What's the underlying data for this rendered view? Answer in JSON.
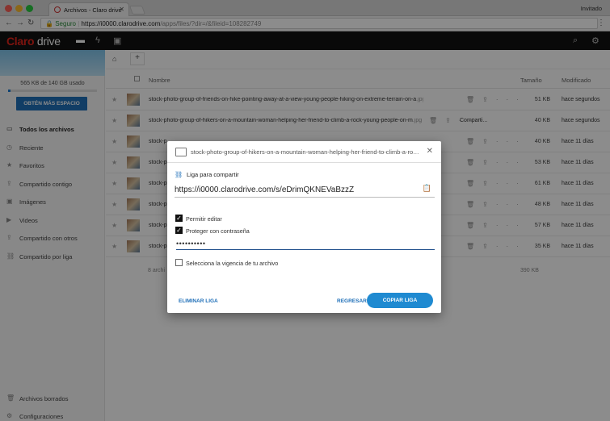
{
  "browser": {
    "tab_title": "Archivos - Claro drive",
    "guest_label": "Invitado",
    "secure_label": "Seguro",
    "url_domain": "https://i0000.clarodrive.com",
    "url_path": "/apps/files/?dir=/&fileid=108282749"
  },
  "app": {
    "logo_claro": "Claro",
    "logo_drive": "drive",
    "accent_color": "#e2231a"
  },
  "sidebar": {
    "usage_text": "565 KB de 140 GB usado",
    "usage_fraction": 0.004,
    "get_more_label": "OBTÉN MÁS ESPACIO",
    "items": [
      {
        "label": "Todos los archivos",
        "icon": "folder-icon"
      },
      {
        "label": "Reciente",
        "icon": "clock-icon"
      },
      {
        "label": "Favoritos",
        "icon": "star-icon"
      },
      {
        "label": "Compartido contigo",
        "icon": "share-icon"
      },
      {
        "label": "Imágenes",
        "icon": "image-icon"
      },
      {
        "label": "Videos",
        "icon": "video-icon"
      },
      {
        "label": "Compartido con otros",
        "icon": "share-icon"
      },
      {
        "label": "Compartido por liga",
        "icon": "link-icon"
      }
    ],
    "trash_label": "Archivos borrados",
    "settings_label": "Configuraciones"
  },
  "table": {
    "header_name": "Nombre",
    "header_size": "Tamaño",
    "header_modified": "Modificado",
    "rows": [
      {
        "name": "stock-photo-group-of-friends-on-hike-pointing-away-at-a-view-young-people-hiking-on-extreme-terrain-on-a",
        "ext": ".jpg",
        "size": "51 KB",
        "modified": "hace segundos"
      },
      {
        "name": "stock-photo-group-of-hikers-on-a-mountain-woman-helping-her-friend-to-climb-a-rock-young-people-on-m",
        "ext": ".jpg",
        "share": "Comparti...",
        "size": "40 KB",
        "modified": "hace segundos"
      },
      {
        "name": "stock-p",
        "ext": "",
        "size": "40 KB",
        "modified": "hace 11 días"
      },
      {
        "name": "stock-p",
        "ext": "",
        "size": "53 KB",
        "modified": "hace 11 días"
      },
      {
        "name": "stock-p",
        "ext": "",
        "size": "61 KB",
        "modified": "hace 11 días"
      },
      {
        "name": "stock-p",
        "ext": "",
        "size": "48 KB",
        "modified": "hace 11 días"
      },
      {
        "name": "stock-p",
        "ext": "",
        "size": "57 KB",
        "modified": "hace 11 días"
      },
      {
        "name": "stock-p",
        "ext": "",
        "size": "35 KB",
        "modified": "hace 11 días"
      }
    ],
    "summary_count": "8 archi",
    "summary_size": "390 KB"
  },
  "modal": {
    "title": "stock-photo-group-of-hikers-on-a-mountain-woman-helping-her-friend-to-climb-a-rock...",
    "share_link_label": "Liga para compartir",
    "link_url": "https://i0000.clarodrive.com/s/eDrimQKNEVaBzzZ",
    "allow_edit_label": "Permitir editar",
    "allow_edit_checked": true,
    "password_label": "Proteger con contraseña",
    "password_checked": true,
    "password_value": "••••••••••",
    "expiry_label": "Selecciona la vigencia de tu archivo",
    "expiry_checked": false,
    "delete_link_label": "ELIMINAR LIGA",
    "back_label": "REGRESAR",
    "copy_link_label": "COPIAR LIGA"
  }
}
